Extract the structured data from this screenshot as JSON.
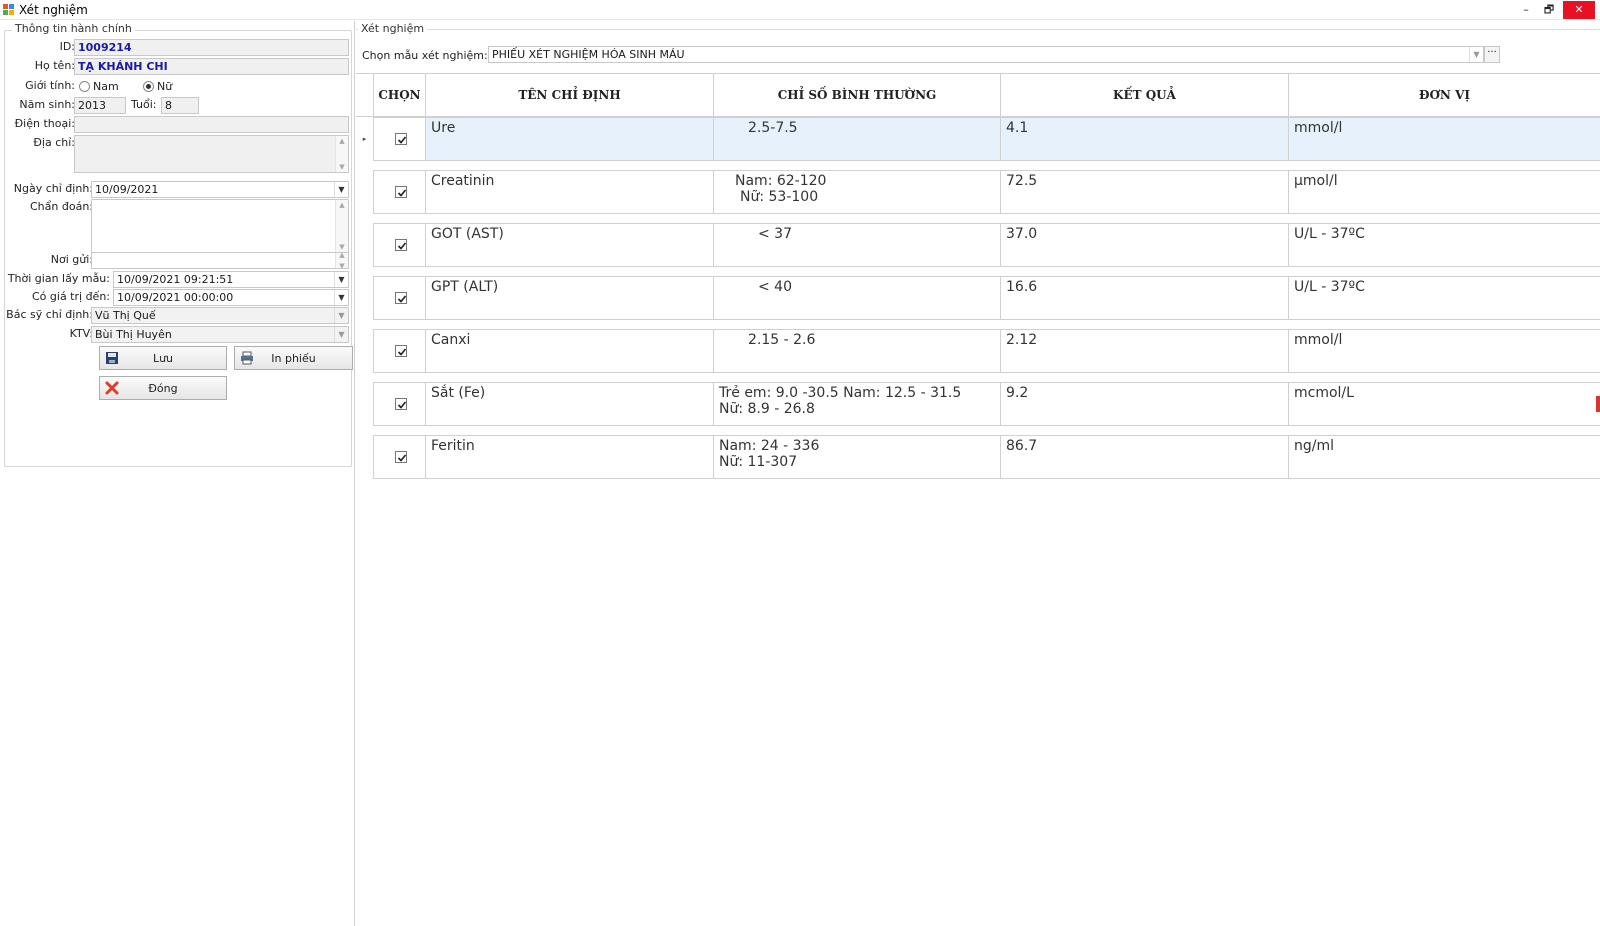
{
  "window": {
    "title": "Xét nghiệm",
    "minimize": "–",
    "restore": "🗗",
    "close": "✕"
  },
  "admin": {
    "group_title": "Thông tin hành chính",
    "id_label": "ID:",
    "id_value": "1009214",
    "name_label": "Họ tên:",
    "name_value": "TẠ KHÁNH CHI",
    "gender_label": "Giới tính:",
    "gender_male": "Nam",
    "gender_female": "Nữ",
    "gender_selected": "Nữ",
    "birth_year_label": "Năm sinh:",
    "birth_year_value": "2013",
    "age_label": "Tuổi:",
    "age_value": "8",
    "phone_label": "Điện thoại:",
    "phone_value": "",
    "address_label": "Địa chỉ:",
    "address_value": "",
    "order_date_label": "Ngày chỉ định:",
    "order_date_value": "10/09/2021",
    "diagnosis_label": "Chẩn đoán:",
    "diagnosis_value": "",
    "sender_label": "Nơi gửi:",
    "sender_value": "",
    "sample_time_label": "Thời gian lấy mẫu:",
    "sample_time_value": "10/09/2021 09:21:51",
    "valid_until_label": "Có giá trị đến:",
    "valid_until_value": "10/09/2021 00:00:00",
    "doctor_label": "Bác sỹ chỉ định:",
    "doctor_value": "Vũ Thị Quế",
    "tech_label": "KTV:",
    "tech_value": "Bùi Thị Huyên",
    "save_button": "Lưu",
    "print_button": "In phiếu",
    "close_button": "Đóng"
  },
  "tests": {
    "group_title": "Xét nghiệm",
    "template_label": "Chọn mẫu xét nghiệm:",
    "template_value": "PHIẾU XÉT NGHIỆM HÓA SINH MÁU",
    "ellipsis": "···",
    "columns": [
      "CHỌN",
      "TÊN CHỈ ĐỊNH",
      "CHỈ SỐ BÌNH THƯỜNG",
      "KẾT QUẢ",
      "ĐƠN VỊ"
    ],
    "rows": [
      {
        "name": "Ure",
        "normal_1": "2.5-7.5",
        "normal_2": "",
        "result": "4.1",
        "unit": "mmol/l",
        "checked": true
      },
      {
        "name": "Creatinin",
        "normal_1": "Nam: 62-120",
        "normal_2": "Nữ: 53-100",
        "result": "72.5",
        "unit": "µmol/l",
        "checked": true
      },
      {
        "name": "GOT (AST)",
        "normal_1": "< 37",
        "normal_2": "",
        "result": "37.0",
        "unit": "U/L - 37ºC",
        "checked": true
      },
      {
        "name": "GPT (ALT)",
        "normal_1": "< 40",
        "normal_2": "",
        "result": "16.6",
        "unit": "U/L - 37ºC",
        "checked": true
      },
      {
        "name": "Canxi",
        "normal_1": "2.15 - 2.6",
        "normal_2": "",
        "result": "2.12",
        "unit": "mmol/l",
        "checked": true
      },
      {
        "name": "Sắt (Fe)",
        "normal_1": "Trẻ em: 9.0 -30.5 Nam: 12.5 - 31.5",
        "normal_2": "Nữ: 8.9 - 26.8",
        "result": "9.2",
        "unit": "mcmol/L",
        "checked": true
      },
      {
        "name": "Feritin",
        "normal_1": "Nam: 24 - 336",
        "normal_2": "Nữ: 11-307",
        "result": "86.7",
        "unit": "ng/ml",
        "checked": true
      }
    ]
  },
  "colors": {
    "selected_row": "#e6f1fb",
    "close_button": "#e81123",
    "bold_text": "#1a1aa6"
  }
}
